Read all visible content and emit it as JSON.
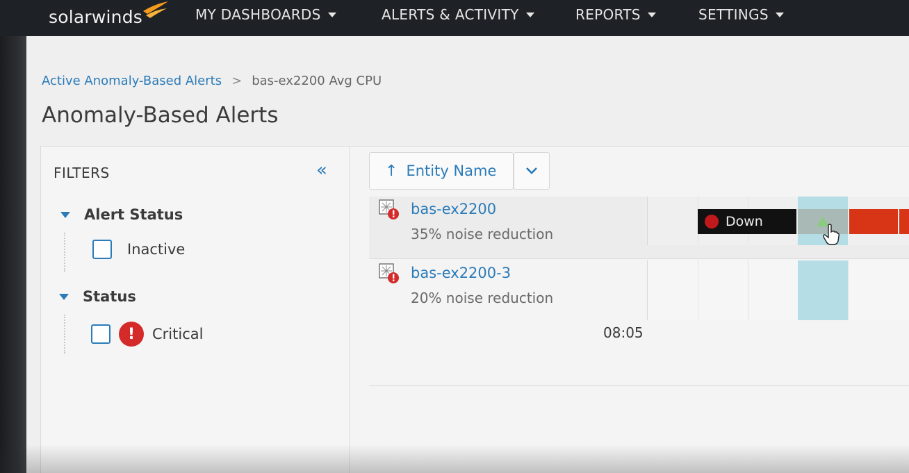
{
  "brand": {
    "name": "solarwinds",
    "mark_color": "#f59b1c"
  },
  "nav": {
    "items": [
      {
        "label": "MY DASHBOARDS"
      },
      {
        "label": "ALERTS & ACTIVITY"
      },
      {
        "label": "REPORTS"
      },
      {
        "label": "SETTINGS"
      }
    ]
  },
  "breadcrumb": {
    "parent": "Active Anomaly-Based Alerts",
    "separator": ">",
    "current": "bas-ex2200 Avg CPU"
  },
  "page": {
    "title": "Anomaly-Based Alerts"
  },
  "filters": {
    "title": "FILTERS",
    "collapse_icon": "«",
    "groups": [
      {
        "label": "Alert Status",
        "options": [
          {
            "label": "Inactive",
            "checked": false
          }
        ]
      },
      {
        "label": "Status",
        "options": [
          {
            "label": "Critical",
            "checked": false,
            "icon": "critical-icon"
          }
        ]
      }
    ]
  },
  "sort": {
    "arrow": "↑",
    "label": "Entity Name"
  },
  "entities": [
    {
      "name": "bas-ex2200",
      "detail": "35% noise reduction",
      "status_label": "Down"
    },
    {
      "name": "bas-ex2200-3",
      "detail": "20% noise reduction"
    }
  ],
  "timeline": {
    "time_label": "08:05"
  },
  "colors": {
    "accent": "#2b7bb9",
    "critical": "#d42a2a",
    "down_bar": "#111111",
    "alert_segment": "#d83416",
    "highlight": "#b5dde6"
  }
}
